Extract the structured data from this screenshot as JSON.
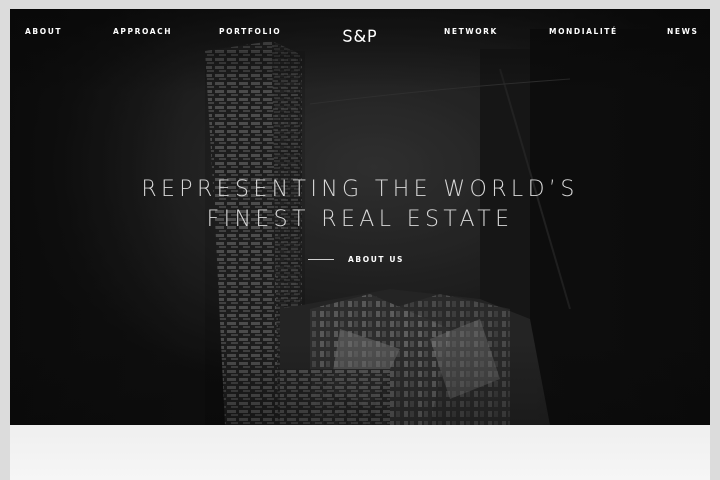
{
  "nav": {
    "items": [
      {
        "label": "ABOUT"
      },
      {
        "label": "APPROACH"
      },
      {
        "label": "PORTFOLIO"
      },
      {
        "label": "NETWORK"
      },
      {
        "label": "MONDIALITÉ"
      },
      {
        "label": "NEWS"
      }
    ],
    "logo_text": "S&P"
  },
  "hero": {
    "headline_line1": "REPRESENTING THE WORLD’S",
    "headline_line2": "FINEST REAL ESTATE",
    "cta_label": "ABOUT US"
  },
  "colors": {
    "hero_background": "#141414",
    "text": "#ffffff",
    "headline": "#d8d8d8",
    "page_background": "#f4f4f4"
  }
}
